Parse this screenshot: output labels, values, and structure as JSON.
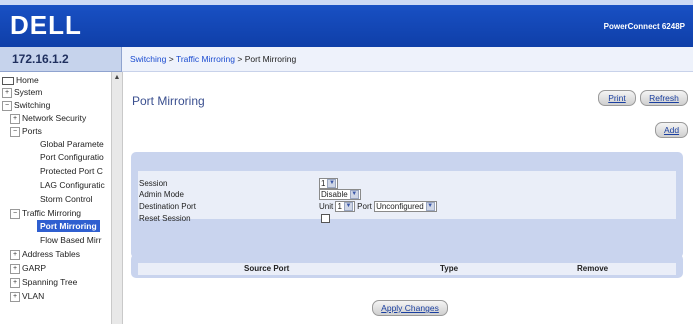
{
  "header": {
    "logo": "DELL",
    "product": "PowerConnect 6248P"
  },
  "ip": "172.16.1.2",
  "breadcrumb": {
    "part1": "Switching",
    "sep1": ">",
    "part2": "Traffic Mirroring",
    "sep2": ">",
    "current": "Port Mirroring"
  },
  "sidebar": {
    "items": [
      {
        "label": "Home",
        "icon": "folder-icon"
      },
      {
        "label": "System",
        "icon": "expand-icon"
      },
      {
        "label": "Switching",
        "icon": "collapse-icon"
      },
      {
        "label": "Network Security",
        "icon": "expand-icon"
      },
      {
        "label": "Ports",
        "icon": "collapse-icon"
      },
      {
        "label": "Global Paramete"
      },
      {
        "label": "Port Configuratio"
      },
      {
        "label": "Protected Port C"
      },
      {
        "label": "LAG Configuratic"
      },
      {
        "label": "Storm Control"
      },
      {
        "label": "Traffic Mirroring",
        "icon": "collapse-icon"
      },
      {
        "label": "Port Mirroring"
      },
      {
        "label": "Flow Based Mirr"
      },
      {
        "label": "Address Tables",
        "icon": "expand-icon"
      },
      {
        "label": "GARP",
        "icon": "expand-icon"
      },
      {
        "label": "Spanning Tree",
        "icon": "expand-icon"
      },
      {
        "label": "VLAN",
        "icon": "expand-icon"
      }
    ]
  },
  "page": {
    "title": "Port Mirroring",
    "print_label": "Print",
    "refresh_label": "Refresh",
    "add_label": "Add",
    "apply_label": "Apply Changes"
  },
  "form": {
    "session_label": "Session",
    "session_value": "1",
    "admin_mode_label": "Admin Mode",
    "admin_mode_value": "Disable",
    "dest_port_label": "Destination Port",
    "unit_label": "Unit",
    "unit_value": "1",
    "port_label": "Port",
    "port_value": "Unconfigured",
    "reset_label": "Reset Session"
  },
  "table": {
    "col_source": "Source Port",
    "col_type": "Type",
    "col_remove": "Remove"
  },
  "colors": {
    "header_blue": "#1a52c7",
    "panel_blue": "#c9d4ee",
    "selected": "#2f5fd0"
  }
}
